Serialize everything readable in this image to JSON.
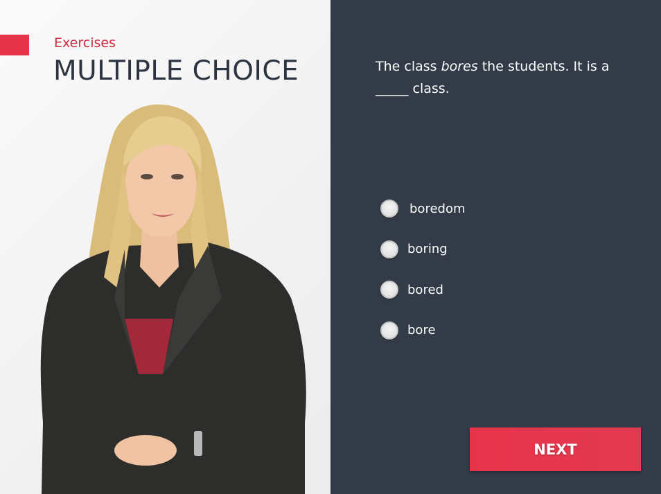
{
  "header": {
    "eyebrow": "Exercises",
    "title": "MULTIPLE CHOICE"
  },
  "question": {
    "before": "The class ",
    "emphasis": "bores",
    "after": " the students. It is a _____ class."
  },
  "options": [
    {
      "label": "boredom"
    },
    {
      "label": "boring"
    },
    {
      "label": "bored"
    },
    {
      "label": "bore"
    }
  ],
  "next_button": {
    "label": "NEXT"
  },
  "colors": {
    "accent": "#e8344b",
    "panel": "#323b47",
    "title": "#2b3440"
  }
}
